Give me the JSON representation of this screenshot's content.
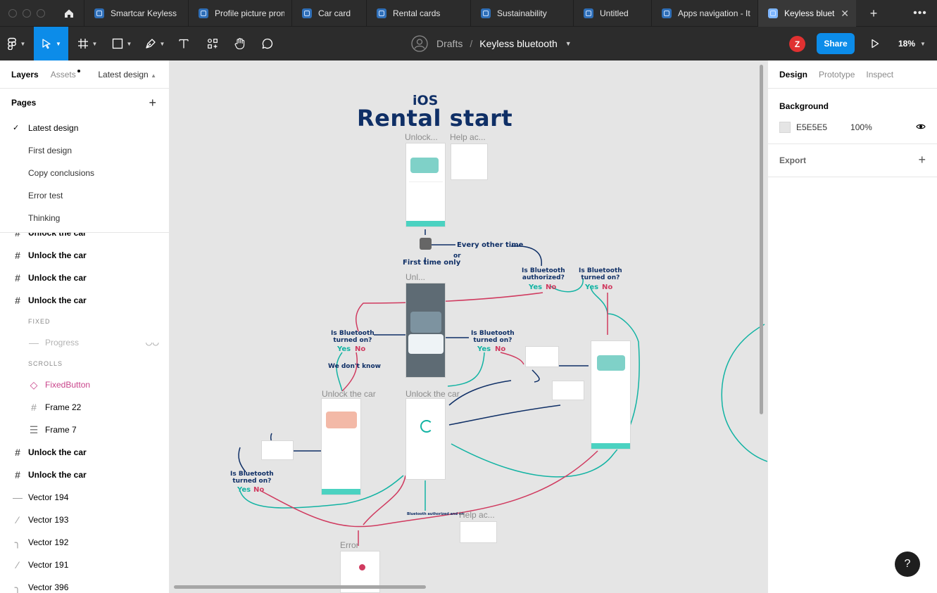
{
  "tabs": [
    {
      "label": "Smartcar Keyless"
    },
    {
      "label": "Profile picture prompt"
    },
    {
      "label": "Car card"
    },
    {
      "label": "Rental cards"
    },
    {
      "label": "Sustainability"
    },
    {
      "label": "Untitled"
    },
    {
      "label": "Apps navigation - Iterations"
    },
    {
      "label": "Keyless bluetooth",
      "close": "✕"
    }
  ],
  "toolbar": {
    "breadcrumb_root": "Drafts",
    "breadcrumb_sep": "/",
    "file_name": "Keyless bluetooth",
    "avatar_initial": "Z",
    "share_label": "Share",
    "zoom": "18%"
  },
  "left_panel": {
    "tabs": {
      "layers": "Layers",
      "assets": "Assets"
    },
    "page_selector": "Latest design",
    "pages_title": "Pages",
    "pages": [
      "Latest design",
      "First design",
      "Copy conclusions",
      "Error test",
      "Thinking"
    ],
    "layers": [
      {
        "label": "Unlock the car",
        "icon": "frame-icon"
      },
      {
        "label": "Unlock the car",
        "icon": "frame-icon"
      },
      {
        "label": "Unlock the car",
        "icon": "frame-icon"
      },
      {
        "label": "Unlock the car",
        "icon": "frame-icon"
      }
    ],
    "fixed_label": "FIXED",
    "progress_label": "Progress",
    "scrolls_label": "SCROLLS",
    "fixed_button": "FixedButton",
    "frame22": "Frame 22",
    "frame7": "Frame 7",
    "layers_after": [
      {
        "label": "Unlock the car"
      },
      {
        "label": "Unlock the car"
      }
    ],
    "vectors": [
      "Vector 194",
      "Vector 193",
      "Vector 192",
      "Vector 191",
      "Vector 396"
    ]
  },
  "canvas": {
    "platform": "iOS",
    "title": "Rental start",
    "frame_labels": {
      "unlock_top": "Unlock...",
      "help_top": "Help ac...",
      "unlock_mid": "Unl...",
      "unlock_left": "Unlock the car",
      "unlock_center": "Unlock the car",
      "help_bottom": "Help ac...",
      "error": "Error"
    },
    "flow": {
      "every_other_time": "Every other time",
      "first_time_only": "First time only",
      "or": "or",
      "bt_authorized": "Is Bluetooth\nauthorized?",
      "bt_on_right": "Is Bluetooth\nturned on?",
      "bt_on_left": "Is Bluetooth\nturned on?",
      "bt_on_mid": "Is Bluetooth\nturned on?",
      "bt_on_bottom": "Is Bluetooth\nturned on?",
      "yes": "Yes",
      "no": "No",
      "we_dont_know": "We  don't know",
      "bt_auth_on": "Bluetooth authorized and on"
    }
  },
  "right_panel": {
    "tabs": {
      "design": "Design",
      "prototype": "Prototype",
      "inspect": "Inspect"
    },
    "background_title": "Background",
    "background_hex": "E5E5E5",
    "background_opacity": "100%",
    "export_title": "Export"
  },
  "colors": {
    "accent": "#0c8ce9",
    "canvas_bg": "#e5e5e5",
    "teal": "#12b3a3",
    "pink": "#d03a5f",
    "navy": "#0f2f66"
  }
}
